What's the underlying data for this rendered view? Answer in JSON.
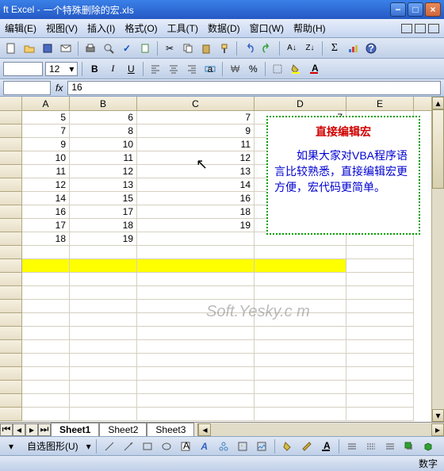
{
  "titlebar": {
    "app": "ft Excel - ",
    "doc": "一个特殊删除的宏.xls"
  },
  "menu": {
    "edit": "编辑(E)",
    "view": "视图(V)",
    "insert": "插入(I)",
    "format": "格式(O)",
    "tools": "工具(T)",
    "data": "数据(D)",
    "window": "窗口(W)",
    "help": "帮助(H)"
  },
  "fmt": {
    "fontsize": "12",
    "bold": "B",
    "italic": "I",
    "underline": "U"
  },
  "formula": {
    "name": "",
    "fx": "fx",
    "value": "16"
  },
  "cols": {
    "A": "A",
    "B": "B",
    "C": "C",
    "D": "D",
    "E": "E"
  },
  "data_rows": [
    {
      "A": "5",
      "B": "6",
      "C": "7",
      "D": "7"
    },
    {
      "A": "7",
      "B": "8",
      "C": "9",
      "D": ""
    },
    {
      "A": "9",
      "B": "10",
      "C": "11",
      "D": ""
    },
    {
      "A": "10",
      "B": "11",
      "C": "12",
      "D": ""
    },
    {
      "A": "11",
      "B": "12",
      "C": "13",
      "D": ""
    },
    {
      "A": "12",
      "B": "13",
      "C": "14",
      "D": ""
    },
    {
      "A": "14",
      "B": "15",
      "C": "16",
      "D": ""
    },
    {
      "A": "16",
      "B": "17",
      "C": "18",
      "D": ""
    },
    {
      "A": "17",
      "B": "18",
      "C": "19",
      "D": ""
    },
    {
      "A": "18",
      "B": "19",
      "C": "",
      "D": ""
    }
  ],
  "textbox": {
    "title": "直接编辑宏",
    "body": "如果大家对VBA程序语言比较熟悉，直接编辑宏更方便，宏代码更简单。"
  },
  "watermark": "Soft.Yesky.c   m",
  "sheets": {
    "s1": "Sheet1",
    "s2": "Sheet2",
    "s3": "Sheet3"
  },
  "drawbar": {
    "label": "自选图形(U)"
  },
  "status": {
    "mode": "数字"
  }
}
